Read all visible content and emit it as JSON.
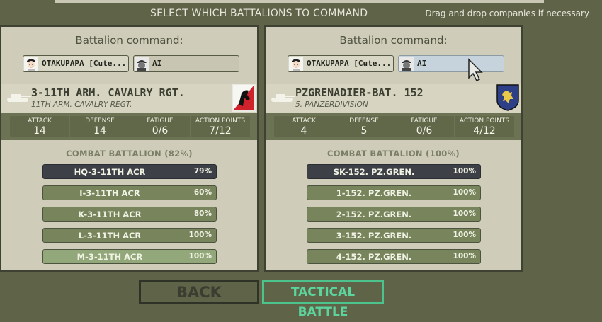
{
  "header": {
    "title": "SELECT WHICH BATTALIONS TO COMMAND",
    "hint": "Drag and drop companies if necessary"
  },
  "left": {
    "command_label": "Battalion command:",
    "player_name": "OTAKUPAPA [Cute...",
    "ai_name": "AI",
    "unit_name": "3-11TH ARM. CAVALRY RGT.",
    "unit_sub": "11TH ARM. CAVALRY REGT.",
    "stats": [
      {
        "label": "ATTACK",
        "value": "14"
      },
      {
        "label": "DEFENSE",
        "value": "14"
      },
      {
        "label": "FATIGUE",
        "value": "0/6"
      },
      {
        "label": "ACTION POINTS",
        "value": "7/12"
      }
    ],
    "battalion_title": "COMBAT BATTALION (82%)",
    "companies": [
      {
        "name": "HQ-3-11TH ACR",
        "pct": "79%"
      },
      {
        "name": "I-3-11TH ACR",
        "pct": "60%"
      },
      {
        "name": "K-3-11TH ACR",
        "pct": "80%"
      },
      {
        "name": "L-3-11TH ACR",
        "pct": "100%"
      },
      {
        "name": "M-3-11TH ACR",
        "pct": "100%"
      }
    ]
  },
  "right": {
    "command_label": "Battalion command:",
    "player_name": "OTAKUPAPA [Cute...",
    "ai_name": "AI",
    "unit_name": "PZGRENADIER-BAT. 152",
    "unit_sub": "5. PANZERDIVISION",
    "stats": [
      {
        "label": "ATTACK",
        "value": "4"
      },
      {
        "label": "DEFENSE",
        "value": "5"
      },
      {
        "label": "FATIGUE",
        "value": "0/6"
      },
      {
        "label": "ACTION POINTS",
        "value": "4/12"
      }
    ],
    "battalion_title": "COMBAT BATTALION (100%)",
    "companies": [
      {
        "name": "SK-152. PZ.GREN.",
        "pct": "100%"
      },
      {
        "name": "1-152. PZ.GREN.",
        "pct": "100%"
      },
      {
        "name": "2-152. PZ.GREN.",
        "pct": "100%"
      },
      {
        "name": "3-152. PZ.GREN.",
        "pct": "100%"
      },
      {
        "name": "4-152. PZ.GREN.",
        "pct": "100%"
      }
    ]
  },
  "buttons": {
    "back": "BACK",
    "tactical": "TACTICAL BATTLE"
  },
  "colors": {
    "background": "#5f6348",
    "panel": "#cfcdb9",
    "company": "#77845c",
    "company_dark": "#3d4147",
    "tactical_accent": "#4cc38c"
  }
}
